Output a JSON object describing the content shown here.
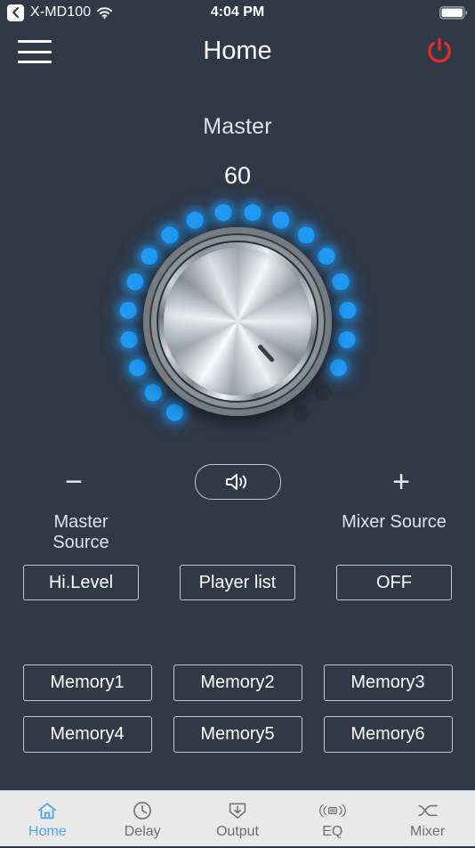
{
  "status_bar": {
    "back_icon": "chevron-left-icon",
    "carrier": "X-MD100",
    "wifi_icon": "wifi-icon",
    "time": "4:04 PM",
    "battery_icon": "battery-full-icon"
  },
  "nav": {
    "menu_icon": "hamburger-menu-icon",
    "title": "Home",
    "power_icon": "power-icon",
    "power_color": "#e82b2b"
  },
  "master": {
    "label": "Master",
    "value": "60",
    "knob": {
      "led_total": 20,
      "led_lit": 18,
      "led_on_color": "#1f9bf5",
      "led_off_color": "#2b313d",
      "pointer_angle_deg": 135
    }
  },
  "controls": {
    "decrement_label": "−",
    "increment_label": "+",
    "speaker_icon": "speaker-volume-icon",
    "master_source_label": "Master Source",
    "mixer_source_label": "Mixer Source",
    "master_source_value": "Hi.Level",
    "player_list_label": "Player list",
    "mixer_source_value": "OFF"
  },
  "memory": {
    "buttons": [
      "Memory1",
      "Memory2",
      "Memory3",
      "Memory4",
      "Memory5",
      "Memory6"
    ]
  },
  "tabbar": {
    "active_color": "#4fa8e8",
    "inactive_color": "#6e6e6e",
    "items": [
      {
        "label": "Home",
        "icon": "home-icon",
        "active": true
      },
      {
        "label": "Delay",
        "icon": "clock-icon",
        "active": false
      },
      {
        "label": "Output",
        "icon": "output-download-icon",
        "active": false
      },
      {
        "label": "EQ",
        "icon": "eq-signal-icon",
        "active": false
      },
      {
        "label": "Mixer",
        "icon": "mixer-shuffle-icon",
        "active": false
      }
    ]
  },
  "theme": {
    "background": "#313846",
    "tabbar_background": "#e9e9e9",
    "text_primary": "#ffffff",
    "text_secondary": "#dfe2e8",
    "outline": "#c3c8cf"
  }
}
